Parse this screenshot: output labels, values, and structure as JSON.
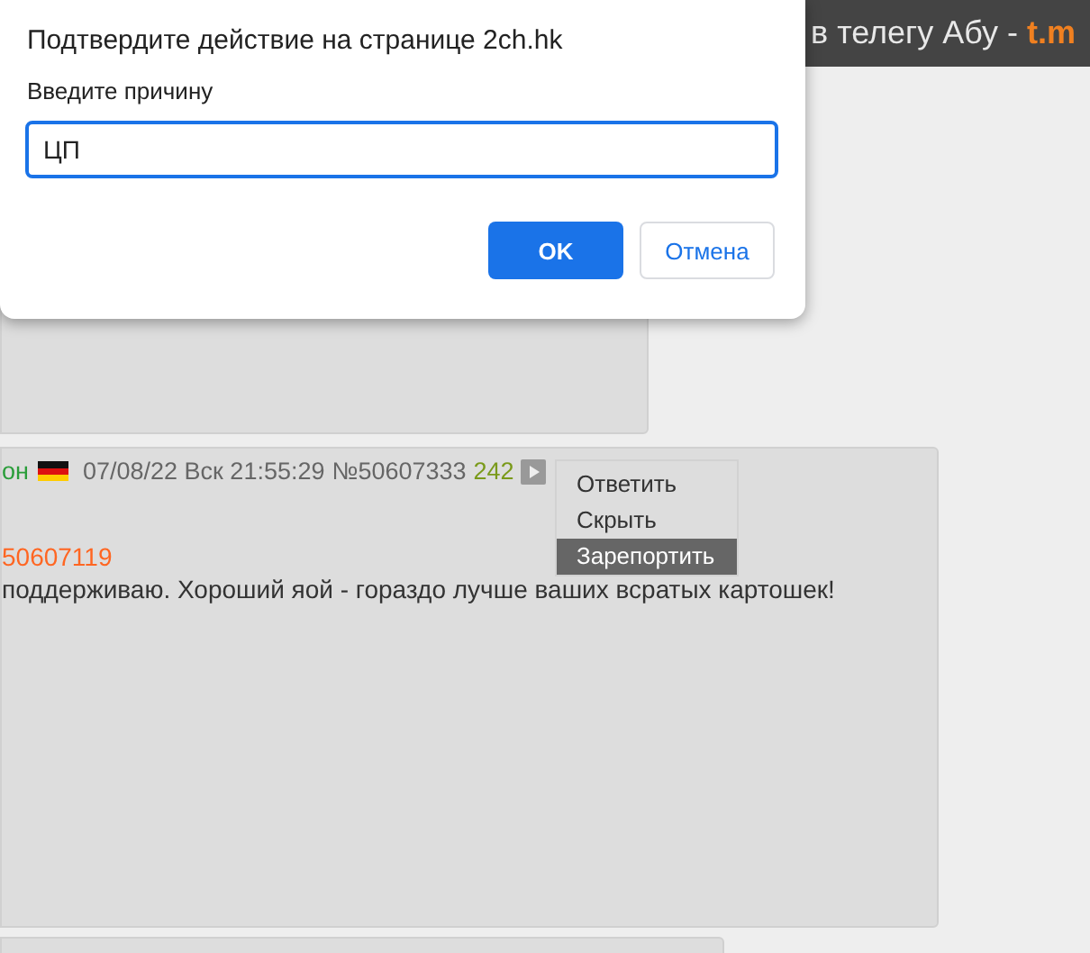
{
  "banner": {
    "text": "в телегу Абу -",
    "link": "t.m"
  },
  "post": {
    "name": "он",
    "date": "07/08/22 Вск 21:55:29",
    "number": "№50607333",
    "count": "242",
    "reply_link": "50607119",
    "body": "поддерживаю. Хороший яой - гораздо лучше ваших всратых картошек!"
  },
  "menu": [
    {
      "label": "Ответить",
      "selected": false
    },
    {
      "label": "Скрыть",
      "selected": false
    },
    {
      "label": "Зарепортить",
      "selected": true
    }
  ],
  "dialog": {
    "title": "Подтвердите действие на странице 2ch.hk",
    "label": "Введите причину",
    "value": "ЦП",
    "buttons": [
      {
        "label": "OK",
        "kind": "primary"
      },
      {
        "label": "Отмена",
        "kind": "secondary"
      }
    ]
  }
}
